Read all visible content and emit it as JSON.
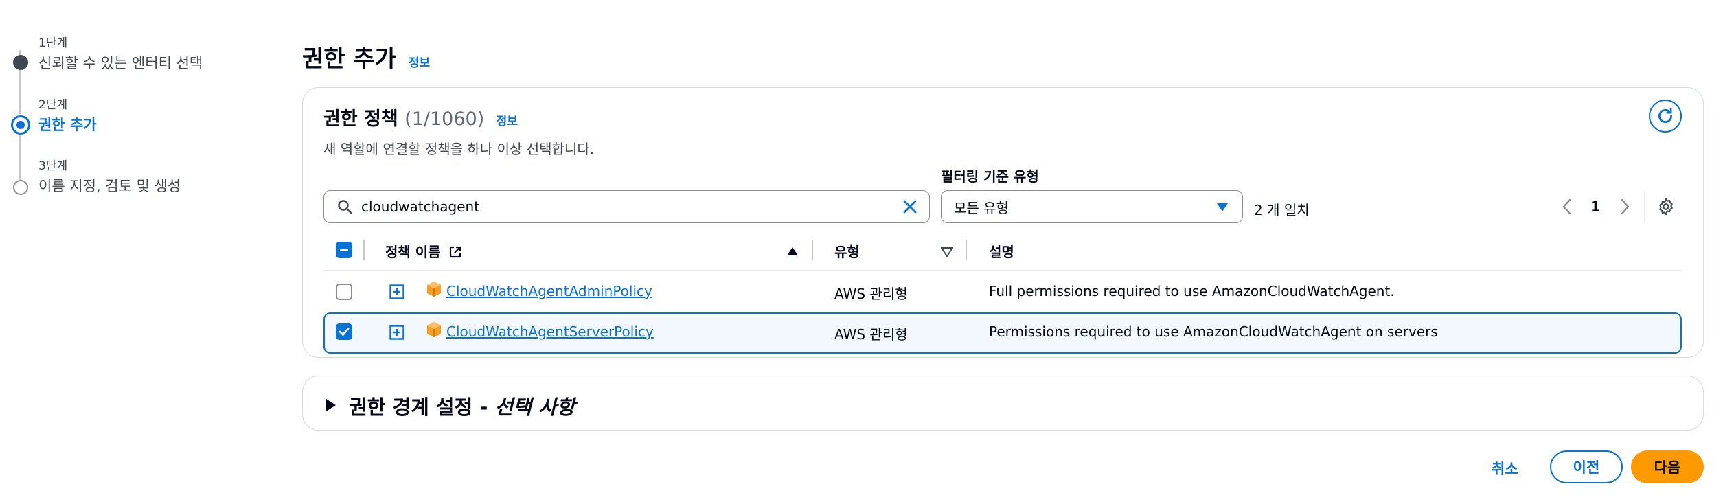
{
  "steps": [
    {
      "number": "1단계",
      "title": "신뢰할 수 있는 엔터티 선택",
      "state": "complete"
    },
    {
      "number": "2단계",
      "title": "권한 추가",
      "state": "active"
    },
    {
      "number": "3단계",
      "title": "이름 지정, 검토 및 생성",
      "state": "pending"
    }
  ],
  "header": {
    "title": "권한 추가",
    "info": "정보"
  },
  "policies": {
    "title": "권한 정책",
    "count": "(1/1060)",
    "info": "정보",
    "description": "새 역할에 연결할 정책을 하나 이상 선택합니다.",
    "search_value": "cloudwatchagent",
    "filter_label": "필터링 기준 유형",
    "filter_value": "모든 유형",
    "match_text": "2 개 일치",
    "page": "1",
    "columns": {
      "name": "정책 이름",
      "type": "유형",
      "description": "설명"
    },
    "rows": [
      {
        "name": "CloudWatchAgentAdminPolicy",
        "type": "AWS 관리형",
        "description": "Full permissions required to use AmazonCloudWatchAgent.",
        "selected": false
      },
      {
        "name": "CloudWatchAgentServerPolicy",
        "type": "AWS 관리형",
        "description": "Permissions required to use AmazonCloudWatchAgent on servers",
        "selected": true
      }
    ]
  },
  "boundary": {
    "title": "권한 경계 설정 - ",
    "optional": "선택 사항"
  },
  "actions": {
    "cancel": "취소",
    "previous": "이전",
    "next": "다음"
  },
  "colors": {
    "accent": "#0972d3",
    "primary": "#ff9900",
    "aws_icon": "#f89d24"
  }
}
